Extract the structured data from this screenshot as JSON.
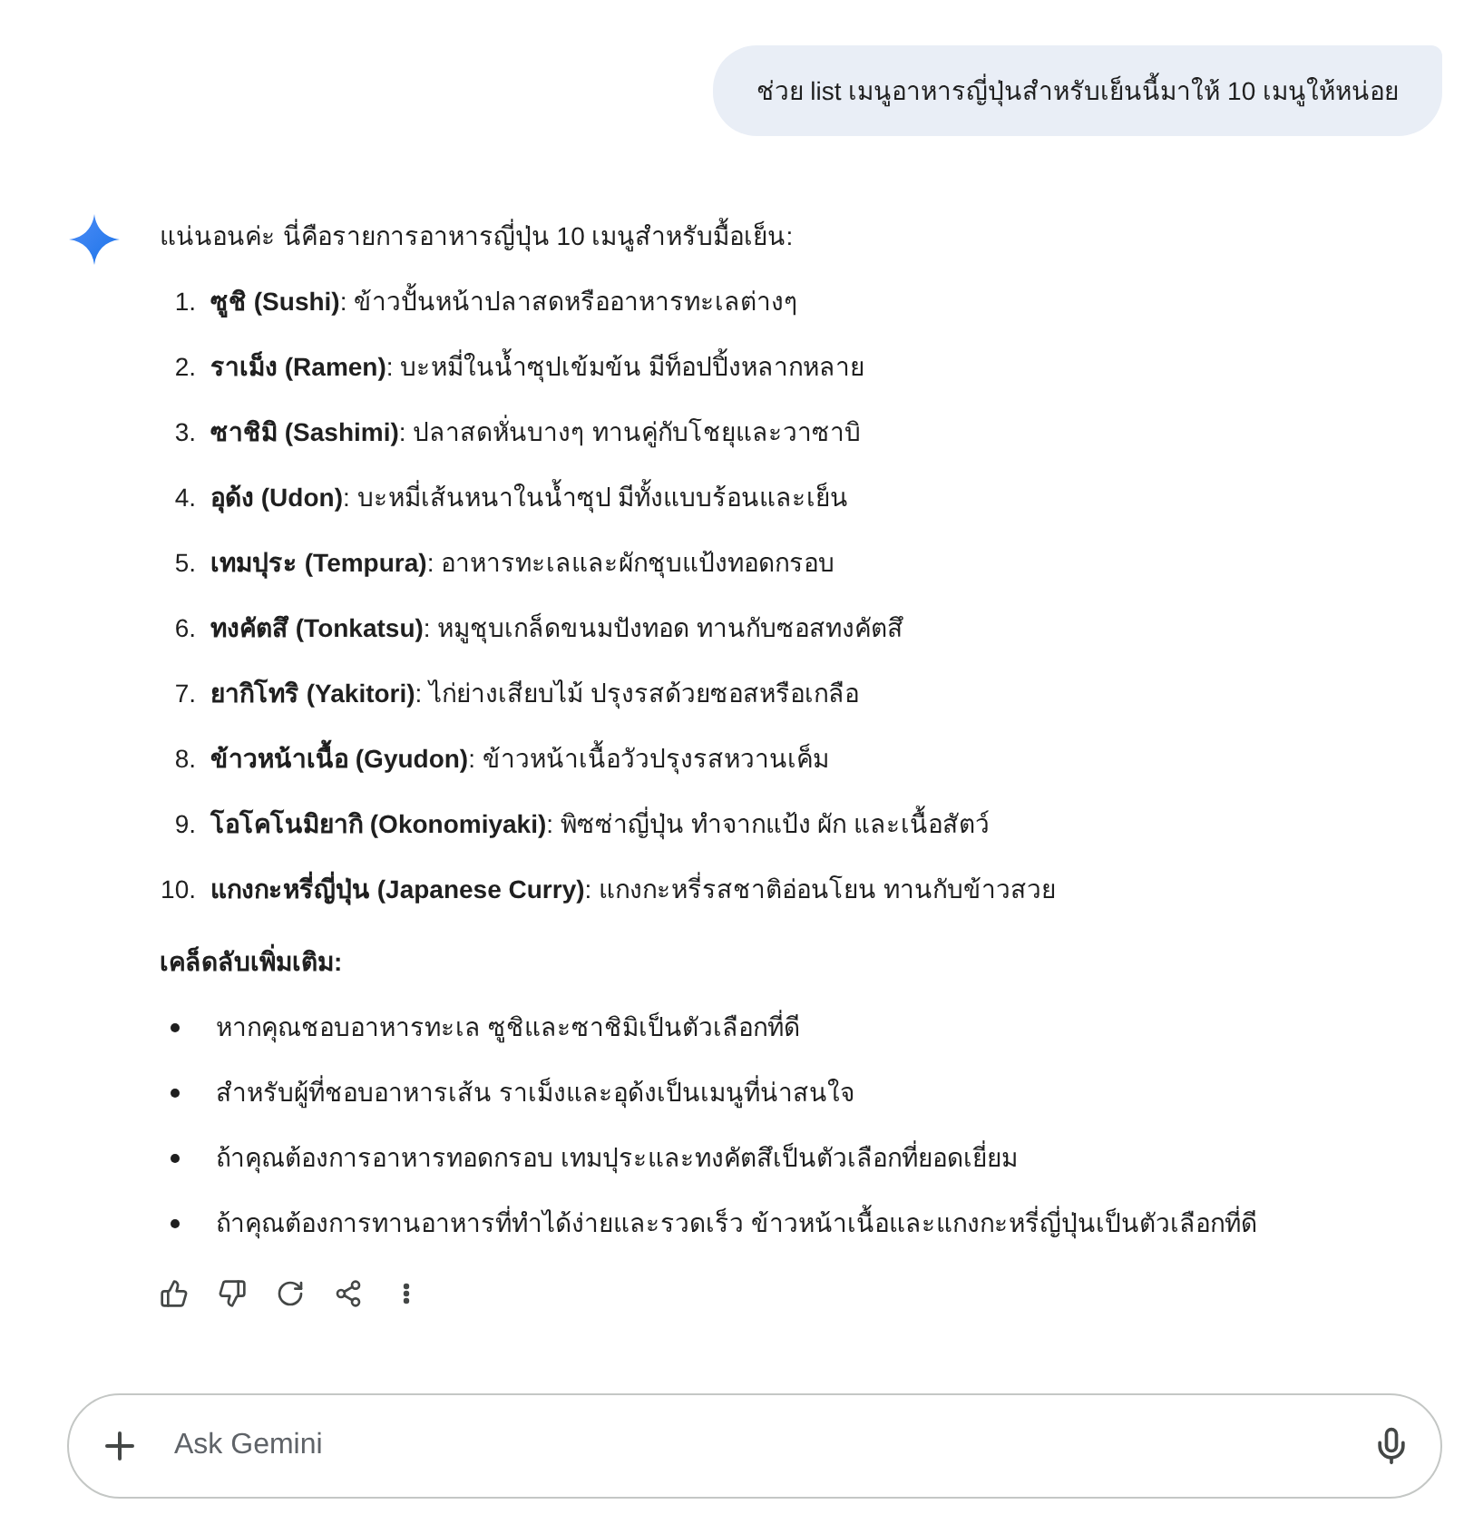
{
  "user_message": "ช่วย list เมนูอาหารญี่ปุ่นสำหรับเย็นนี้มาให้ 10 เมนูให้หน่อย",
  "response": {
    "intro": "แน่นอนค่ะ นี่คือรายการอาหารญี่ปุ่น 10 เมนูสำหรับมื้อเย็น:",
    "items": [
      {
        "number": "1.",
        "text": "**ซูชิ (Sushi)**: ข้าวปั้นหน้าปลาสดหรืออาหารทะเลต่างๆ"
      },
      {
        "number": "2.",
        "text": "**ราเม็ง (Ramen)**: บะหมี่ในน้ำซุปเข้มข้น มีท็อปปิ้งหลากหลาย"
      },
      {
        "number": "3.",
        "text": "**ซาชิมิ (Sashimi)**: ปลาสดหั่นบางๆ ทานคู่กับโชยุและวาซาบิ"
      },
      {
        "number": "4.",
        "text": "**อุด้ง (Udon)**: บะหมี่เส้นหนาในน้ำซุป มีทั้งแบบร้อนและเย็น"
      },
      {
        "number": "5.",
        "text": "**เทมปุระ (Tempura)**: อาหารทะเลและผักชุบแป้งทอดกรอบ"
      },
      {
        "number": "6.",
        "text": "**ทงคัตสึ (Tonkatsu)**: หมูชุบเกล็ดขนมปังทอด ทานกับซอสทงคัตสึ"
      },
      {
        "number": "7.",
        "text": "**ยากิโทริ (Yakitori)**: ไก่ย่างเสียบไม้ ปรุงรสด้วยซอสหรือเกลือ"
      },
      {
        "number": "8.",
        "text": "**ข้าวหน้าเนื้อ (Gyudon)**: ข้าวหน้าเนื้อวัวปรุงรสหวานเค็ม"
      },
      {
        "number": "9.",
        "text": "**โอโคโนมิยากิ (Okonomiyaki)**: พิซซ่าญี่ปุ่น ทำจากแป้ง ผัก และเนื้อสัตว์"
      },
      {
        "number": "10.",
        "text": "**แกงกะหรี่ญี่ปุ่น (Japanese Curry)**: แกงกะหรี่รสชาติอ่อนโยน ทานกับข้าวสวย"
      }
    ],
    "tips_heading": "เคล็ดลับเพิ่มเติม:",
    "tips": [
      "หากคุณชอบอาหารทะเล ซูชิและซาชิมิเป็นตัวเลือกที่ดี",
      "สำหรับผู้ที่ชอบอาหารเส้น ราเม็งและอุด้งเป็นเมนูที่น่าสนใจ",
      "ถ้าคุณต้องการอาหารทอดกรอบ เทมปุระและทงคัตสึเป็นตัวเลือกที่ยอดเยี่ยม",
      "ถ้าคุณต้องการทานอาหารที่ทำได้ง่ายและรวดเร็ว ข้าวหน้าเนื้อและแกงกะหรี่ญี่ปุ่นเป็นตัวเลือกที่ดี"
    ]
  },
  "input": {
    "placeholder": "Ask Gemini"
  }
}
